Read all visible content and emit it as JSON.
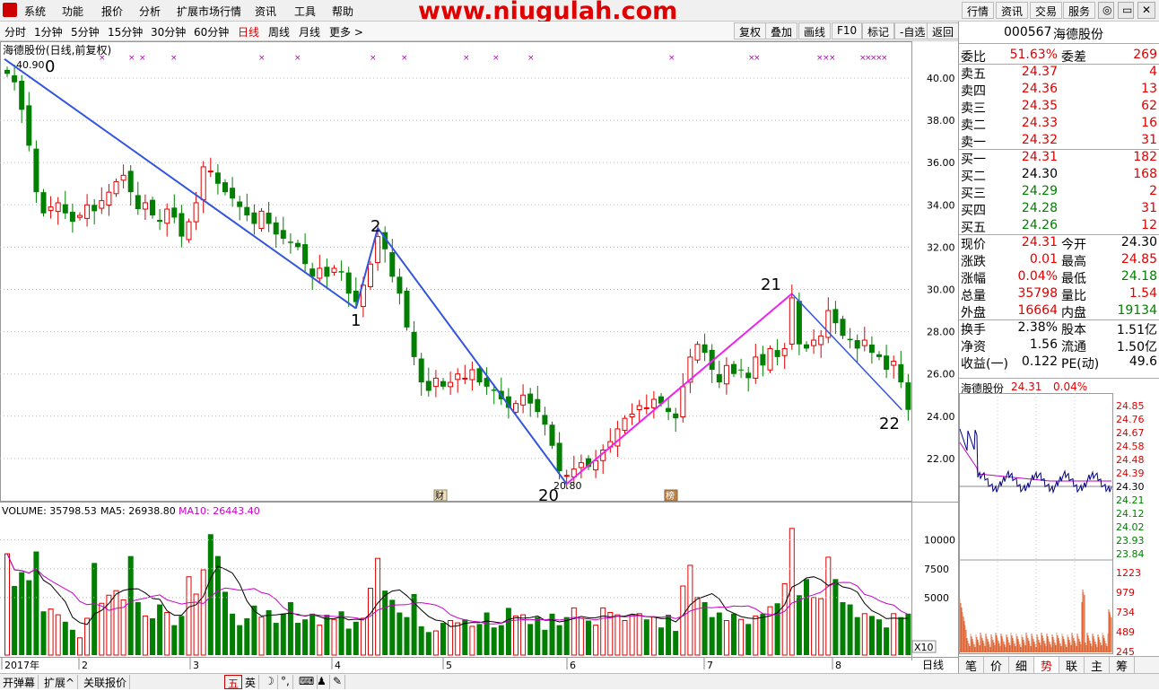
{
  "menubar": {
    "items": [
      "系统",
      "功能",
      "报价",
      "分析",
      "扩展市场行情",
      "资讯",
      "工具",
      "帮助"
    ],
    "watermark": "www.niugulah.com",
    "right_tabs": [
      "行情",
      "资讯",
      "交易",
      "服务"
    ]
  },
  "periods": [
    "分时",
    "1分钟",
    "5分钟",
    "15分钟",
    "30分钟",
    "60分钟",
    "日线",
    "周线",
    "月线",
    "更多 >"
  ],
  "active_period": "日线",
  "tools": [
    "复权",
    "叠加",
    "画线",
    "F10",
    "标记",
    "-自选",
    "返回"
  ],
  "chart": {
    "title": "海德股份(日线,前复权)",
    "high_label": "40.90",
    "low_label": "20.80",
    "wave_labels": [
      "0",
      "1",
      "2",
      "20",
      "21",
      "22"
    ],
    "price_ticks": [
      "40.00",
      "38.00",
      "36.00",
      "34.00",
      "32.00",
      "30.00",
      "28.00",
      "26.00",
      "24.00",
      "22.00"
    ],
    "date_labels": [
      "2017年",
      "2",
      "3",
      "4",
      "5",
      "6",
      "7",
      "8"
    ],
    "period_label": "日线",
    "events": [
      "财",
      "榜"
    ],
    "volume_header": {
      "vol": "VOLUME: 35798.53",
      "ma5": "MA5: 26938.80",
      "ma10": "MA10: 26443.40"
    },
    "volume_ticks": [
      "10000",
      "7500",
      "5000"
    ],
    "volume_unit": "X10"
  },
  "chart_data": {
    "type": "candlestick",
    "title": "海德股份(日线,前复权)",
    "ylim": [
      20,
      41
    ],
    "high": 40.9,
    "low": 20.8,
    "closes": [
      40.2,
      39.8,
      38.5,
      36.8,
      34.6,
      33.6,
      33.9,
      34.1,
      33.6,
      33.2,
      33.5,
      34.0,
      33.7,
      34.2,
      34.6,
      35.1,
      35.4,
      34.6,
      33.8,
      34.1,
      33.5,
      33.2,
      33.8,
      33.4,
      32.5,
      33.2,
      34.1,
      35.8,
      35.6,
      35.0,
      34.6,
      34.3,
      33.9,
      33.5,
      33.1,
      33.7,
      33.1,
      32.6,
      32.4,
      32.2,
      32.0,
      31.2,
      30.6,
      31.0,
      30.6,
      31.0,
      30.8,
      29.8,
      29.4,
      30.2,
      31.2,
      32.5,
      31.9,
      30.6,
      29.8,
      28.2,
      26.8,
      25.6,
      25.2,
      25.8,
      25.4,
      25.6,
      26.0,
      25.8,
      26.2,
      25.6,
      25.4,
      25.2,
      24.8,
      24.4,
      24.6,
      25.0,
      24.6,
      24.2,
      23.6,
      22.6,
      21.4,
      21.2,
      21.5,
      21.8,
      21.6,
      21.9,
      22.4,
      22.8,
      23.4,
      23.9,
      24.1,
      24.5,
      24.4,
      24.8,
      24.6,
      24.2,
      23.9,
      25.4,
      26.8,
      27.4,
      27.0,
      26.2,
      25.6,
      26.4,
      26.0,
      26.2,
      25.8,
      26.8,
      26.4,
      27.2,
      26.8,
      27.2,
      29.6,
      27.4,
      27.2,
      27.6,
      27.8,
      29.0,
      28.4,
      27.8,
      27.6,
      27.2,
      27.6,
      27.0,
      26.8,
      26.2,
      26.6,
      25.6,
      24.3
    ],
    "volume_ylim": [
      0,
      12000
    ],
    "volumes": [
      8800,
      6000,
      7200,
      6500,
      9000,
      3800,
      4000,
      3500,
      2900,
      2200,
      1500,
      3200,
      8000,
      4500,
      5200,
      5600,
      4800,
      8600,
      4600,
      3400,
      3200,
      4400,
      3700,
      2600,
      3400,
      6800,
      5300,
      7400,
      10500,
      8600,
      5500,
      3600,
      2600,
      3200,
      4300,
      3300,
      3900,
      2800,
      3600,
      4600,
      2800,
      3100,
      3600,
      2600,
      3500,
      3100,
      3800,
      2300,
      2900,
      3200,
      5800,
      8400,
      5600,
      4800,
      3700,
      3300,
      5300,
      2500,
      2000,
      2100,
      2800,
      3000,
      2800,
      3100,
      2500,
      2700,
      3700,
      2400,
      2600,
      4100,
      3400,
      3500,
      2700,
      3300,
      2200,
      3600,
      2600,
      3300,
      4100,
      3200,
      3000,
      2600,
      4100,
      3700,
      3500,
      3000,
      3500,
      3600,
      3100,
      3300,
      2400,
      3500,
      2100,
      6000,
      7800,
      5000,
      4600,
      3300,
      3700,
      3000,
      3600,
      3100,
      2700,
      3400,
      3600,
      4200,
      4500,
      6200,
      11000,
      5200,
      6600,
      5000,
      4900,
      8500,
      6600,
      4600,
      4400,
      3300,
      3600,
      3400,
      3100,
      2400,
      3600,
      3300,
      3600
    ]
  },
  "quote": {
    "code": "000567",
    "name": "海德股份",
    "rows": [
      {
        "label": "委比",
        "value": "51.63%",
        "label2": "委差",
        "value2": "269",
        "c1": "red",
        "c2": "red"
      },
      {
        "label": "卖五",
        "value": "24.37",
        "value2": "4",
        "c1": "red",
        "c2": "red"
      },
      {
        "label": "卖四",
        "value": "24.36",
        "value2": "13",
        "c1": "red",
        "c2": "red"
      },
      {
        "label": "卖三",
        "value": "24.35",
        "value2": "62",
        "c1": "red",
        "c2": "red"
      },
      {
        "label": "卖二",
        "value": "24.33",
        "value2": "16",
        "c1": "red",
        "c2": "red"
      },
      {
        "label": "卖一",
        "value": "24.32",
        "value2": "31",
        "c1": "red",
        "c2": "red"
      },
      {
        "label": "买一",
        "value": "24.31",
        "value2": "182",
        "c1": "red",
        "c2": "red"
      },
      {
        "label": "买二",
        "value": "24.30",
        "value2": "168",
        "c1": "black",
        "c2": "red"
      },
      {
        "label": "买三",
        "value": "24.29",
        "value2": "2",
        "c1": "green",
        "c2": "red"
      },
      {
        "label": "买四",
        "value": "24.28",
        "value2": "31",
        "c1": "green",
        "c2": "red"
      },
      {
        "label": "买五",
        "value": "24.26",
        "value2": "12",
        "c1": "green",
        "c2": "red"
      },
      {
        "label": "现价",
        "value": "24.31",
        "label2": "今开",
        "value2": "24.30",
        "c1": "red",
        "c2": "black"
      },
      {
        "label": "涨跌",
        "value": "0.01",
        "label2": "最高",
        "value2": "24.85",
        "c1": "red",
        "c2": "red"
      },
      {
        "label": "涨幅",
        "value": "0.04%",
        "label2": "最低",
        "value2": "24.18",
        "c1": "red",
        "c2": "green"
      },
      {
        "label": "总量",
        "value": "35798",
        "label2": "量比",
        "value2": "1.54",
        "c1": "red",
        "c2": "red"
      },
      {
        "label": "外盘",
        "value": "16664",
        "label2": "内盘",
        "value2": "19134",
        "c1": "red",
        "c2": "green"
      },
      {
        "label": "换手",
        "value": "2.38%",
        "label2": "股本",
        "value2": "1.51亿",
        "c1": "black",
        "c2": "black"
      },
      {
        "label": "净资",
        "value": "1.56",
        "label2": "流通",
        "value2": "1.50亿",
        "c1": "black",
        "c2": "black"
      },
      {
        "label": "收益(一)",
        "value": "0.122",
        "label2": "PE(动)",
        "value2": "49.6",
        "c1": "black",
        "c2": "black"
      }
    ],
    "mini": {
      "name": "海德股份",
      "price": "24.31",
      "pct": "0.04%",
      "price_ticks": [
        "24.85",
        "24.76",
        "24.67",
        "24.58",
        "24.48",
        "24.39",
        "24.30",
        "24.21",
        "24.12",
        "24.02",
        "23.93",
        "23.84"
      ],
      "vol_ticks": [
        "1223",
        "979",
        "734",
        "489",
        "245"
      ]
    },
    "bottom_tabs": [
      "笔",
      "价",
      "细",
      "势",
      "联",
      "主",
      "筹"
    ],
    "active_tab": "势"
  },
  "statusbar": {
    "items": [
      "开弹幕",
      "扩展^",
      "关联报价"
    ],
    "ime": [
      "五",
      "英"
    ]
  },
  "colors": {
    "up": "#e00000",
    "down": "#007f00",
    "wave": "#3355dd",
    "wave2": "#ee22ee",
    "ma5": "#000000",
    "ma10": "#cc00cc"
  }
}
